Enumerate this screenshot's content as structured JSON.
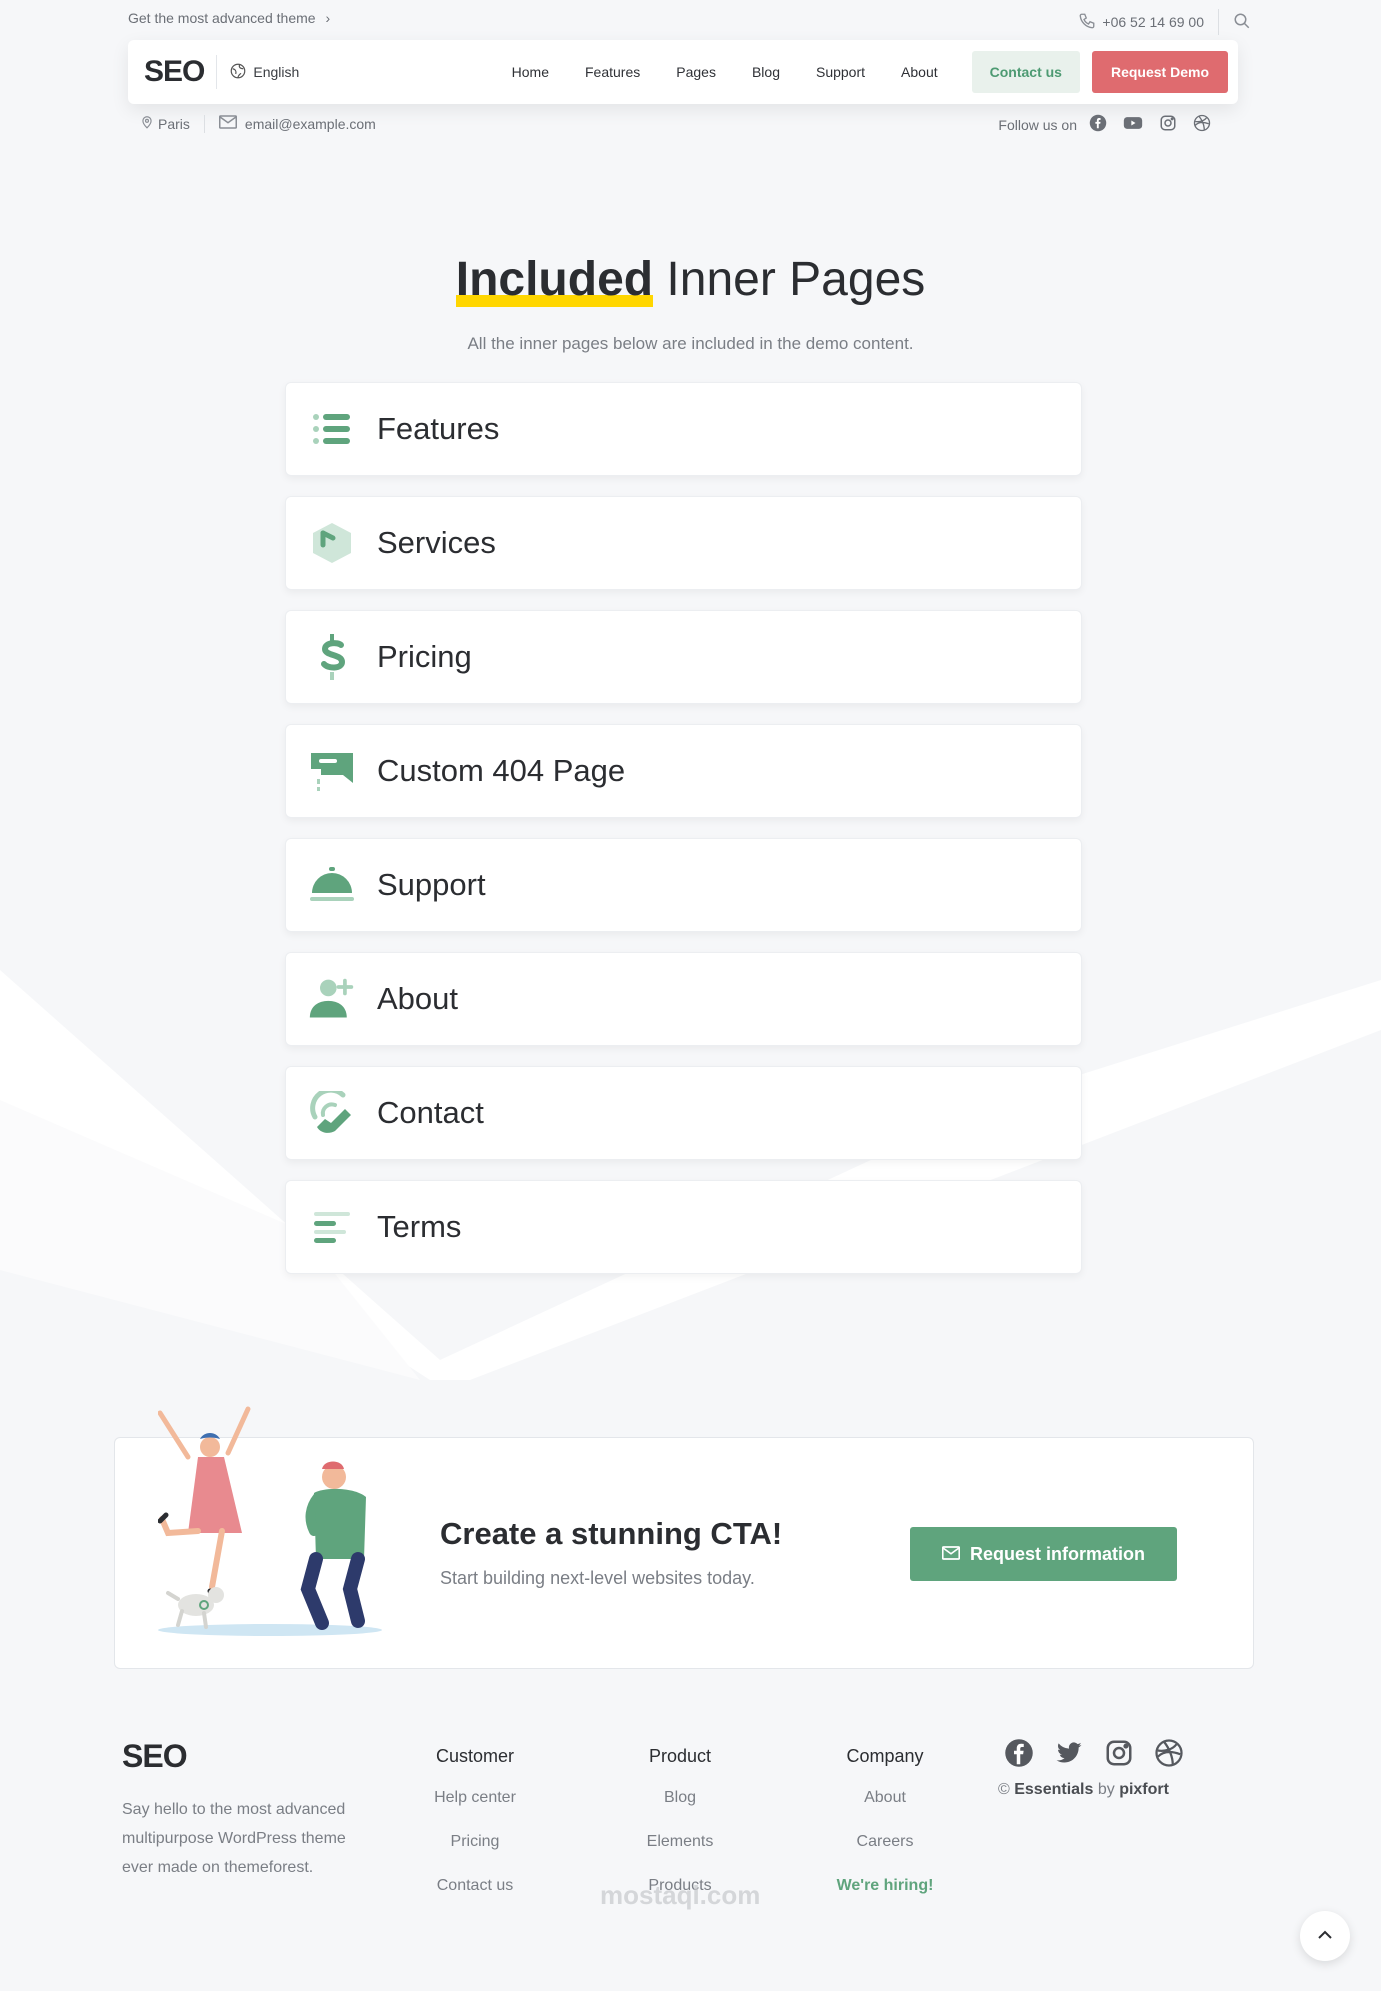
{
  "topbar": {
    "promo": "Get the most advanced theme",
    "phone": "+06 52 14 69 00"
  },
  "header": {
    "logo": "SEO",
    "language": "English",
    "nav": [
      "Home",
      "Features",
      "Pages",
      "Blog",
      "Support",
      "About"
    ],
    "contact_label": "Contact us",
    "demo_label": "Request Demo"
  },
  "subbar": {
    "city": "Paris",
    "email": "email@example.com",
    "follow": "Follow us on"
  },
  "section": {
    "title_highlight": "Included",
    "title_rest": "Inner Pages",
    "subtitle": "All the inner pages below are included in the demo content."
  },
  "pages": [
    {
      "label": "Features",
      "icon": "list-icon"
    },
    {
      "label": "Services",
      "icon": "box-icon"
    },
    {
      "label": "Pricing",
      "icon": "dollar-icon"
    },
    {
      "label": "Custom 404 Page",
      "icon": "broken-sign-icon"
    },
    {
      "label": "Support",
      "icon": "service-bell-icon"
    },
    {
      "label": "About",
      "icon": "add-user-icon"
    },
    {
      "label": "Contact",
      "icon": "phone-icon"
    },
    {
      "label": "Terms",
      "icon": "text-lines-icon"
    }
  ],
  "cta": {
    "title": "Create a stunning CTA!",
    "subtitle": "Start building next-level websites today.",
    "button": "Request information"
  },
  "footer": {
    "logo": "SEO",
    "description": "Say hello to the most advanced multipurpose WordPress theme ever made on themeforest.",
    "columns": [
      {
        "title": "Customer",
        "links": [
          "Help center",
          "Pricing",
          "Contact us"
        ]
      },
      {
        "title": "Product",
        "links": [
          "Blog",
          "Elements",
          "Products"
        ]
      },
      {
        "title": "Company",
        "links": [
          "About",
          "Careers",
          "We're hiring!"
        ]
      }
    ],
    "copyright_prefix": "© ",
    "copyright_brand": "Essentials",
    "copyright_by": " by ",
    "copyright_author": "pixfort"
  },
  "watermark": "mostaql.com",
  "colors": {
    "accent": "#5fa47d",
    "accent_light": "#a9d2bb",
    "demo": "#df6b6f",
    "highlight": "#ffd600"
  }
}
